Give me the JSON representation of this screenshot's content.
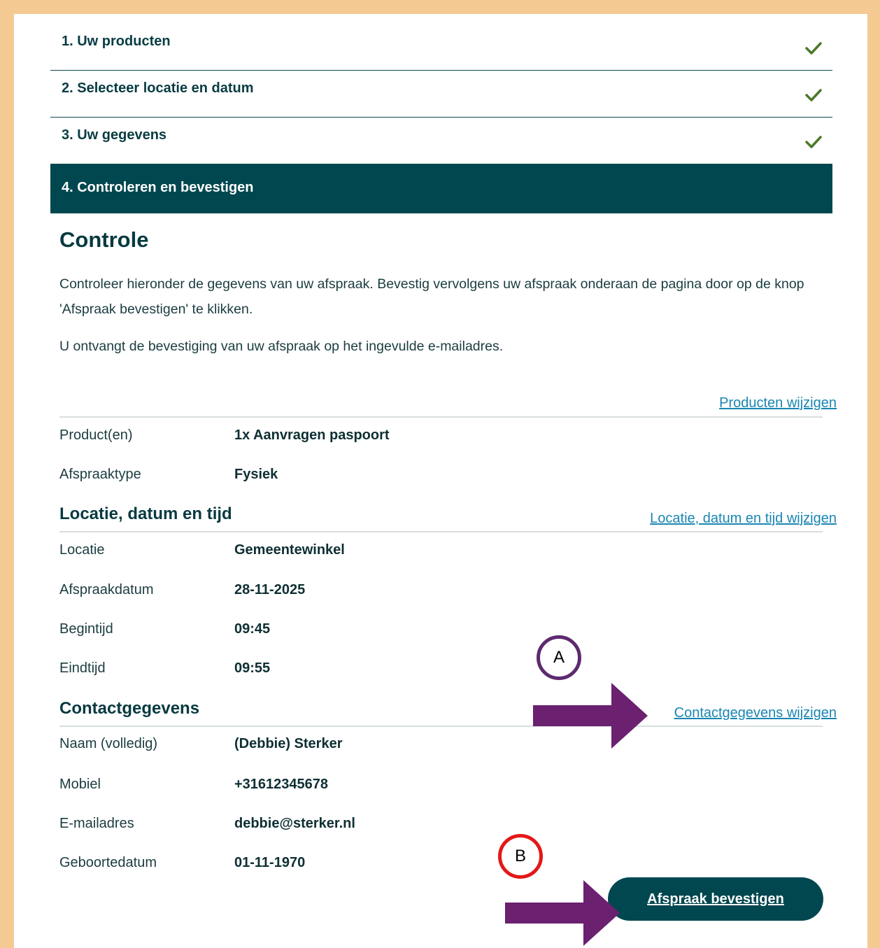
{
  "steps": [
    {
      "label": "1. Uw producten",
      "status": "done"
    },
    {
      "label": "2. Selecteer locatie en datum",
      "status": "done"
    },
    {
      "label": "3. Uw gegevens",
      "status": "done"
    },
    {
      "label": "4. Controleren en bevestigen",
      "status": "active"
    }
  ],
  "controle": {
    "title": "Controle",
    "intro": "Controleer hieronder de gegevens van uw afspraak. Bevestig vervolgens uw afspraak onderaan de pagina door op de knop 'Afspraak bevestigen' te klikken.",
    "intro2": "U ontvangt de bevestiging van uw afspraak op het ingevulde e-mailadres."
  },
  "products": {
    "change_link": "Producten wijzigen",
    "rows": [
      {
        "label": "Product(en)",
        "value": "1x Aanvragen paspoort"
      },
      {
        "label": "Afspraaktype",
        "value": "Fysiek"
      }
    ]
  },
  "location": {
    "title": "Locatie, datum en tijd",
    "change_link": "Locatie, datum en tijd wijzigen",
    "rows": [
      {
        "label": "Locatie",
        "value": "Gemeentewinkel"
      },
      {
        "label": "Afspraakdatum",
        "value": "28-11-2025"
      },
      {
        "label": "Begintijd",
        "value": "09:45"
      },
      {
        "label": "Eindtijd",
        "value": "09:55"
      }
    ]
  },
  "contact": {
    "title": "Contactgegevens",
    "change_link": "Contactgegevens wijzigen",
    "rows": [
      {
        "label": "Naam (volledig)",
        "value": "(Debbie) Sterker"
      },
      {
        "label": "Mobiel",
        "value": "+31612345678"
      },
      {
        "label": "E-mailadres",
        "value": "debbie@sterker.nl"
      },
      {
        "label": "Geboortedatum",
        "value": "01-11-1970"
      }
    ]
  },
  "confirm_button": "Afspraak bevestigen",
  "annotations": {
    "marker_a": "A",
    "marker_b": "B",
    "arrow_color": "#6b2070"
  },
  "colors": {
    "accent": "#00474f",
    "link": "#1a86b2",
    "check": "#4a7a2a",
    "frame": "#f5c992"
  }
}
